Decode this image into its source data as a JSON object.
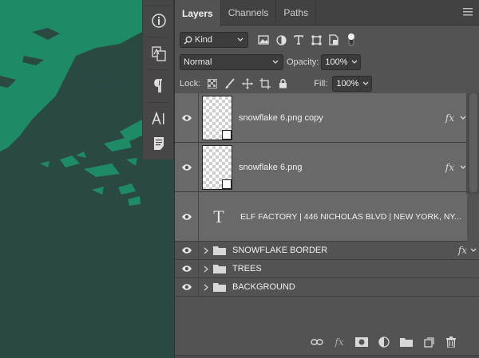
{
  "colors": {
    "canvas_bg": "#2b4943",
    "canvas_art": "#1e8a66",
    "panel_bg": "#535353",
    "selected_row": "#696969"
  },
  "tool_strip": {
    "icons": [
      "info-icon",
      "glyph-swap-icon",
      "paragraph-icon",
      "character-icon",
      "notes-icon"
    ]
  },
  "tabs": [
    {
      "label": "Layers",
      "active": true
    },
    {
      "label": "Channels",
      "active": false
    },
    {
      "label": "Paths",
      "active": false
    }
  ],
  "filter": {
    "kind_label": "Kind",
    "filter_icons": [
      "pixel-filter-icon",
      "adjustment-filter-icon",
      "type-filter-icon",
      "shape-filter-icon",
      "smart-object-filter-icon",
      "filter-toggle-icon"
    ]
  },
  "blend": {
    "mode": "Normal",
    "opacity_label": "Opacity:",
    "opacity_value": "100%"
  },
  "lock": {
    "label": "Lock:",
    "fill_label": "Fill:",
    "fill_value": "100%"
  },
  "layers": [
    {
      "name": "snowflake 6.png copy",
      "kind": "smart-object",
      "fx": "fx"
    },
    {
      "name": "snowflake 6.png",
      "kind": "smart-object",
      "fx": "fx"
    },
    {
      "name": "ELF FACTORY | 446 NICHOLAS BLVD | NEW YORK, NY...",
      "kind": "type",
      "type_glyph": "T"
    },
    {
      "name": "SNOWFLAKE BORDER",
      "kind": "group",
      "fx": "fx"
    },
    {
      "name": "TREES",
      "kind": "group"
    },
    {
      "name": "BACKGROUND",
      "kind": "group"
    }
  ],
  "footer": {
    "fx_label": "fx",
    "buttons": [
      "link-layers-icon",
      "add-style-icon",
      "add-mask-icon",
      "new-adjustment-icon",
      "new-group-icon",
      "new-layer-icon",
      "delete-layer-icon"
    ]
  }
}
